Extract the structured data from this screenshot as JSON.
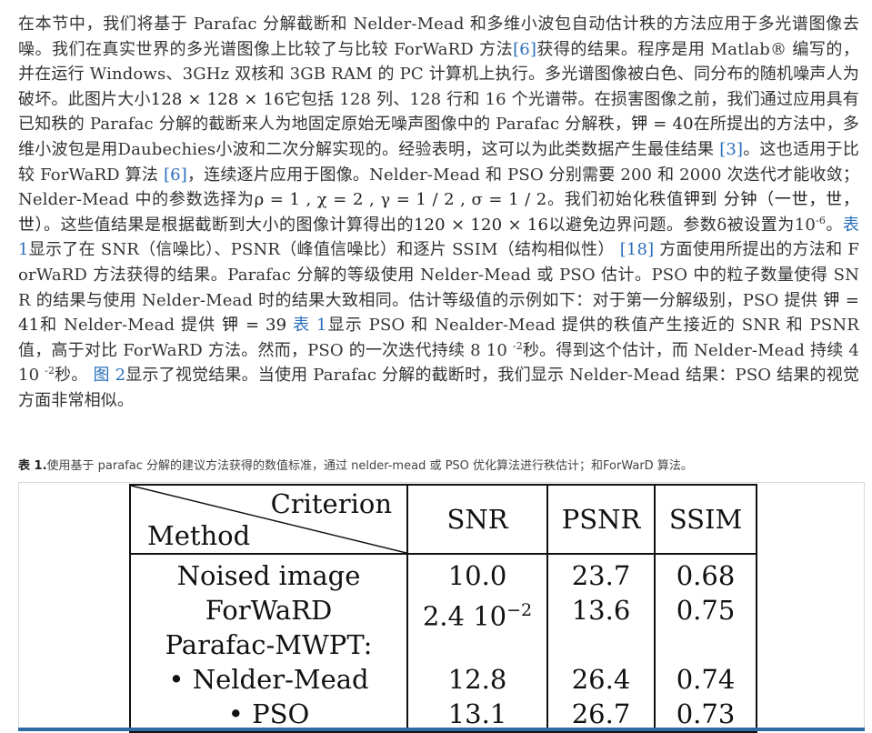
{
  "article": {
    "paragraph_segments": [
      {
        "t": "在本节中，我们将基于 Parafac 分解截断和 Nelder-Mead 和多维小波包自动估计秩的方法应用于多光谱图像去噪。我们在真实世界的多光谱图像上比较了与比较 ForWaRD 方法"
      },
      {
        "t": "[6]",
        "link": true
      },
      {
        "t": "获得的结果。程序是用 Matlab® 编写的，并在运行 Windows、3GHz 双核和 3GB RAM 的 PC 计算机上执行。多光谱图像被白色、同分布的随机噪声人为破坏。此图片大小"
      },
      {
        "t": "128 × 128 × 16",
        "math": true
      },
      {
        "t": "它包括 128 列、128 行和 16 个光谱带。在损害图像之前，我们通过应用具有已知秩的 Parafac 分解的截断来人为地固定原始无噪声图像中的 Parafac 分解秩，"
      },
      {
        "t": "钾 = 40",
        "math": true
      },
      {
        "t": "在所提出的方法中，多维小波包是用Daubechies小波和二次分解实现的。经验表明，这可以为此类数据产生最佳结果 "
      },
      {
        "t": "[3]",
        "link": true
      },
      {
        "t": "。这也适用于比较 ForWaRD 算法 "
      },
      {
        "t": "[6]",
        "link": true
      },
      {
        "t": "，连续逐片应用于图像。Nelder-Mead 和 PSO 分别需要 200 和 2000 次迭代才能收敛；Nelder-Mead 中的参数选择为"
      },
      {
        "t": "ρ = 1 , χ = 2 , γ = 1 / 2 , σ = 1 / 2",
        "math": true
      },
      {
        "t": "。我们初始化秩值"
      },
      {
        "t": "钾",
        "math": true
      },
      {
        "t": "到 分钟（一世，世，世）",
        "math": true
      },
      {
        "t": "。这些值结果是根据截断到大小的图像计算得出的"
      },
      {
        "t": "120 × 120 × 16",
        "math": true
      },
      {
        "t": "以避免边界问题。参数δ被设置为10"
      },
      {
        "t": "-6",
        "sup": true
      },
      {
        "t": "。"
      },
      {
        "t": "表 1",
        "link": true
      },
      {
        "t": "显示了在 SNR（信噪比）、PSNR（峰值信噪比）和逐片 SSIM（结构相似性） "
      },
      {
        "t": "[18]",
        "link": true
      },
      {
        "t": " 方面使用所提出的方法和 ForWaRD 方法获得的结果。Parafac 分解的等级使用 Nelder-Mead 或 PSO 估计。PSO 中的粒子数量使得 SNR 的结果与使用 Nelder-Mead 时的结果大致相同。估计等级值的示例如下：对于第一分解级别，PSO 提供 "
      },
      {
        "t": "钾 = 41",
        "math": true
      },
      {
        "t": "和 Nelder-Mead 提供 "
      },
      {
        "t": "钾 = 39",
        "math": true
      },
      {
        "t": " "
      },
      {
        "t": "表 1",
        "link": true
      },
      {
        "t": "显示 PSO 和 Nealder-Mead 提供的秩值产生接近的 SNR 和 PSNR 值，高于对比 ForWaRD 方法。然而，PSO 的一次迭代持续 8 10 "
      },
      {
        "t": "-2",
        "sup": true
      },
      {
        "t": "秒。得到这个估计，而 Nelder-Mead 持续 4 10 "
      },
      {
        "t": "-2",
        "sup": true
      },
      {
        "t": "秒。 "
      },
      {
        "t": "图 2",
        "link": true
      },
      {
        "t": "显示了视觉结果。当使用 Parafac 分解的截断时，我们显示 Nelder-Mead 结果：PSO 结果的视觉方面非常相似。"
      }
    ]
  },
  "caption": {
    "label": "表 1.",
    "text": "使用基于 parafac 分解的建议方法获得的数值标准，通过 nelder-mead 或 PSO 优化算法进行秩估计；和ForWarD 算法。"
  },
  "table": {
    "header_criterion": "Criterion",
    "header_method": "Method",
    "columns": [
      "SNR",
      "PSNR",
      "SSIM"
    ],
    "rows": [
      {
        "method": "Noised image",
        "snr": "10.0",
        "psnr": "23.7",
        "ssim": "0.68"
      },
      {
        "method": "ForWaRD",
        "snr": "2.4 10",
        "snr_sup": "−2",
        "psnr": "13.6",
        "ssim": "0.75"
      },
      {
        "method": "Parafac-MWPT:",
        "snr": "",
        "psnr": "",
        "ssim": ""
      },
      {
        "method": "• Nelder-Mead",
        "snr": "12.8",
        "psnr": "26.4",
        "ssim": "0.74"
      },
      {
        "method": "• PSO",
        "snr": "13.1",
        "psnr": "26.7",
        "ssim": "0.73"
      }
    ]
  },
  "colors": {
    "link": "#2a6ebb",
    "figure_bar": "#2e6aa4",
    "text": "#333333"
  }
}
